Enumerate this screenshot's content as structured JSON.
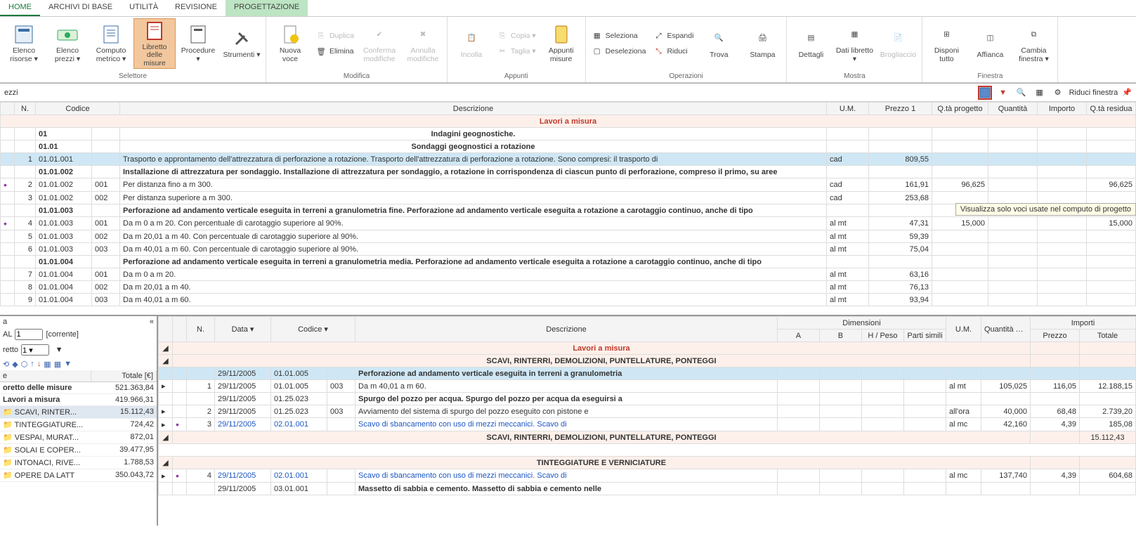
{
  "tabs": [
    "HOME",
    "ARCHIVI DI BASE",
    "UTILITÀ",
    "REVISIONE",
    "PROGETTAZIONE"
  ],
  "ribbon": {
    "selettore": {
      "label": "Selettore",
      "items": [
        "Elenco risorse ▾",
        "Elenco prezzi ▾",
        "Computo metrico ▾",
        "Libretto delle misure",
        "Procedure ▾",
        "Strumenti ▾"
      ]
    },
    "modifica": {
      "label": "Modifica",
      "nuova": "Nuova voce",
      "duplica": "Duplica",
      "elimina": "Elimina",
      "conferma": "Conferma modifiche",
      "annulla": "Annulla modifiche"
    },
    "appunti": {
      "label": "Appunti",
      "incolla": "Incolla",
      "copia": "Copia ▾",
      "taglia": "Taglia ▾",
      "appunti": "Appunti misure"
    },
    "operazioni": {
      "label": "Operazioni",
      "seleziona": "Seleziona",
      "deseleziona": "Deseleziona",
      "espandi": "Espandi",
      "riduci": "Riduci",
      "trova": "Trova",
      "stampa": "Stampa"
    },
    "mostra": {
      "label": "Mostra",
      "dettagli": "Dettagli",
      "dati": "Dati libretto ▾",
      "brogliaccio": "Brogliaccio"
    },
    "finestra": {
      "label": "Finestra",
      "disponi": "Disponi tutto",
      "affianca": "Affianca",
      "cambia": "Cambia finestra ▾"
    }
  },
  "topLabels": {
    "ezzi": "ezzi",
    "riduci": "Riduci finestra"
  },
  "tooltip": "Visualizza solo voci usate nel computo di progetto",
  "topHeaders": {
    "n": "N.",
    "codice": "Codice",
    "descrizione": "Descrizione",
    "um": "U.M.",
    "prezzo1": "Prezzo 1",
    "qprog": "Q.tà progetto",
    "quantita": "Quantità",
    "importo": "Importo",
    "qres": "Q.tà residua"
  },
  "sections": {
    "lavori": "Lavori a misura",
    "indagini": "Indagini geognostiche.",
    "sondaggi": "Sondaggi geognostici a rotazione"
  },
  "topRows": [
    {
      "type": "section",
      "desc": "Lavori a misura"
    },
    {
      "type": "bold",
      "codice": "01",
      "desc": "Indagini geognostiche."
    },
    {
      "type": "bold",
      "codice": "01.01",
      "desc": "Sondaggi geognostici a rotazione"
    },
    {
      "sel": true,
      "n": "1",
      "codice": "01.01.001",
      "desc": "Trasporto e approntamento dell'attrezzatura di perforazione a rotazione. Trasporto dell'attrezzatura di perforazione a rotazione. Sono compresi: il trasporto di",
      "um": "cad",
      "prezzo": "809,55"
    },
    {
      "type": "bold",
      "codice": "01.01.002",
      "desc": "Installazione di attrezzatura per sondaggio. Installazione di attrezzatura per sondaggio, a rotazione in corrispondenza di ciascun punto di perforazione, compreso il primo, su aree"
    },
    {
      "dot": true,
      "n": "2",
      "codice": "01.01.002",
      "sub": "001",
      "desc": "Per distanza fino a m 300.",
      "um": "cad",
      "prezzo": "161,91",
      "qprog": "96,625",
      "qres": "96,625"
    },
    {
      "n": "3",
      "codice": "01.01.002",
      "sub": "002",
      "desc": "Per distanza superiore a m 300.",
      "um": "cad",
      "prezzo": "253,68"
    },
    {
      "type": "bold",
      "codice": "01.01.003",
      "desc": "Perforazione ad andamento verticale eseguita in terreni a granulometria fine. Perforazione ad andamento verticale eseguita a rotazione a carotaggio continuo, anche di tipo"
    },
    {
      "dot": true,
      "n": "4",
      "codice": "01.01.003",
      "sub": "001",
      "desc": "Da m 0 a m 20. Con percentuale di carotaggio superiore al 90%.",
      "um": "al mt",
      "prezzo": "47,31",
      "qprog": "15,000",
      "qres": "15,000"
    },
    {
      "n": "5",
      "codice": "01.01.003",
      "sub": "002",
      "desc": "Da m 20,01 a m 40. Con percentuale di carotaggio superiore al 90%.",
      "um": "al mt",
      "prezzo": "59,39"
    },
    {
      "n": "6",
      "codice": "01.01.003",
      "sub": "003",
      "desc": "Da m 40,01 a m 60. Con percentuale di carotaggio superiore al 90%.",
      "um": "al mt",
      "prezzo": "75,04"
    },
    {
      "type": "bold",
      "codice": "01.01.004",
      "desc": "Perforazione ad andamento verticale eseguita in terreni a granulometria media. Perforazione ad andamento verticale eseguita a rotazione a carotaggio continuo, anche di tipo"
    },
    {
      "n": "7",
      "codice": "01.01.004",
      "sub": "001",
      "desc": "Da m 0 a m 20.",
      "um": "al mt",
      "prezzo": "63,16"
    },
    {
      "n": "8",
      "codice": "01.01.004",
      "sub": "002",
      "desc": "Da m 20,01 a m 40.",
      "um": "al mt",
      "prezzo": "76,13"
    },
    {
      "n": "9",
      "codice": "01.01.004",
      "sub": "003",
      "desc": "Da m 40,01 a m 60.",
      "um": "al mt",
      "prezzo": "93,94"
    }
  ],
  "side": {
    "title": "a",
    "toggle": "«",
    "al": "AL",
    "corrente": "[corrente]",
    "retto": "retto",
    "one": "1",
    "onev": "1 ▾",
    "totale": "Totale [€]",
    "tree": [
      {
        "name": "oretto delle misure",
        "tot": "521.363,84",
        "bold": true
      },
      {
        "name": "Lavori a misura",
        "tot": "419.966,31",
        "bold": true
      },
      {
        "name": "SCAVI, RINTER...",
        "tot": "15.112,43",
        "folder": true,
        "sel": true
      },
      {
        "name": "TINTEGGIATURE...",
        "tot": "724,42",
        "folder": true
      },
      {
        "name": "VESPAI, MURAT...",
        "tot": "872,01",
        "folder": true
      },
      {
        "name": "SOLAI E COPER...",
        "tot": "39.477,95",
        "folder": true
      },
      {
        "name": "INTONACI, RIVE...",
        "tot": "1.788,53",
        "folder": true
      },
      {
        "name": "OPERE DA LATT",
        "tot": "350.043,72",
        "folder": true
      }
    ]
  },
  "btmHeaders": {
    "n": "N.",
    "data": "Data",
    "codice": "Codice",
    "descrizione": "Descrizione",
    "dim": "Dimensioni",
    "a": "A",
    "b": "B",
    "h": "H / Peso",
    "parti": "Parti simili",
    "um": "U.M.",
    "qcalc": "Quantità calcolata",
    "importi": "Importi",
    "prezzo": "Prezzo",
    "totale": "Totale"
  },
  "btmRows": [
    {
      "type": "section",
      "desc": "Lavori a misura",
      "red": true
    },
    {
      "type": "section",
      "desc": "SCAVI, RINTERRI, DEMOLIZIONI, PUNTELLATURE, PONTEGGI"
    },
    {
      "blue": true,
      "data": "29/11/2005",
      "codice": "01.01.005",
      "desc": "Perforazione ad andamento verticale eseguita in terreni a granulometria",
      "bold": true
    },
    {
      "exp": "▸",
      "n": "1",
      "data": "29/11/2005",
      "codice": "01.01.005",
      "sub": "003",
      "desc": "Da m 40,01 a m 60.",
      "um": "al mt",
      "qcalc": "105,025",
      "prezzo": "116,05",
      "totale": "12.188,15"
    },
    {
      "data": "29/11/2005",
      "codice": "01.25.023",
      "desc": "Spurgo del pozzo per acqua. Spurgo del pozzo per acqua da eseguirsi a",
      "bold": true
    },
    {
      "exp": "▸",
      "n": "2",
      "data": "29/11/2005",
      "codice": "01.25.023",
      "sub": "003",
      "desc": "Avviamento del sistema di spurgo del pozzo eseguito con pistone e",
      "um": "all'ora",
      "qcalc": "40,000",
      "prezzo": "68,48",
      "totale": "2.739,20"
    },
    {
      "exp": "▸",
      "dot": true,
      "n": "3",
      "data": "29/11/2005",
      "codice": "02.01.001",
      "desc": "Scavo di sbancamento con uso di mezzi meccanici. Scavo di",
      "link": true,
      "um": "al mc",
      "qcalc": "42,160",
      "prezzo": "4,39",
      "totale": "185,08"
    },
    {
      "type": "section",
      "desc": "SCAVI, RINTERRI, DEMOLIZIONI, PUNTELLATURE, PONTEGGI",
      "totale": "15.112,43"
    },
    {
      "type": "blank"
    },
    {
      "type": "section",
      "desc": "TINTEGGIATURE E VERNICIATURE"
    },
    {
      "exp": "▸",
      "dot": true,
      "n": "4",
      "data": "29/11/2005",
      "codice": "02.01.001",
      "desc": "Scavo di sbancamento con uso di mezzi meccanici. Scavo di",
      "link": true,
      "um": "al mc",
      "qcalc": "137,740",
      "prezzo": "4,39",
      "totale": "604,68"
    },
    {
      "data": "29/11/2005",
      "codice": "03.01.001",
      "desc": "Massetto di sabbia e cemento. Massetto di sabbia e cemento nelle",
      "bold": true
    }
  ]
}
